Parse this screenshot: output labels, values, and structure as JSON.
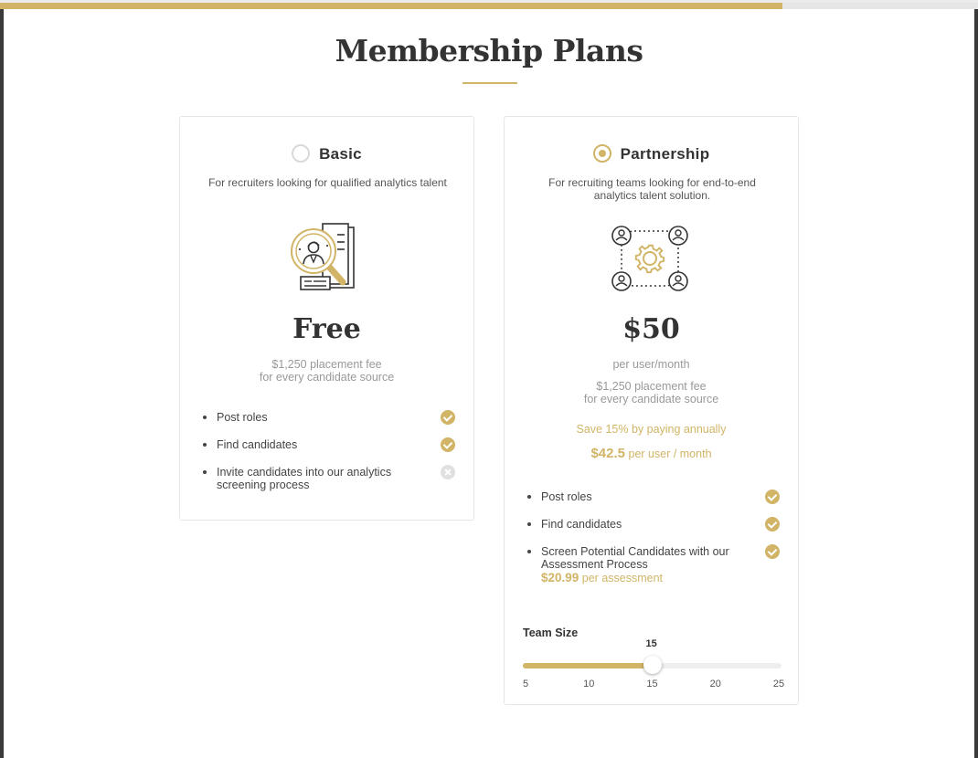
{
  "page": {
    "title": "Membership Plans",
    "progress_percent": 80
  },
  "colors": {
    "accent": "#d1b466",
    "text": "#333333",
    "muted": "#999999",
    "border": "#e6e6e6"
  },
  "plans": {
    "basic": {
      "name": "Basic",
      "selected": false,
      "description": "For recruiters looking for qualified analytics talent",
      "icon": "candidate-search-icon",
      "price": "Free",
      "fee_line1": "$1,250 placement fee",
      "fee_line2": "for every candidate source",
      "features": [
        {
          "label": "Post roles",
          "included": true
        },
        {
          "label": "Find candidates",
          "included": true
        },
        {
          "label": "Invite candidates into our analytics screening process",
          "included": false
        }
      ]
    },
    "partnership": {
      "name": "Partnership",
      "selected": true,
      "description": "For recruiting teams looking for end-to-end analytics talent solution.",
      "icon": "team-network-gear-icon",
      "price": "$50",
      "price_unit": "per user/month",
      "fee_line1": "$1,250 placement fee",
      "fee_line2": "for every candidate source",
      "save_text": "Save 15% by paying annually",
      "annual_price": "$42.5",
      "annual_unit": "per user / month",
      "features": [
        {
          "label": "Post roles",
          "included": true
        },
        {
          "label": "Find candidates",
          "included": true
        },
        {
          "label": "Screen Potential Candidates with our Assessment Process",
          "included": true,
          "price": "$20.99",
          "price_unit": "per assessment"
        }
      ],
      "team_size": {
        "label": "Team Size",
        "value": 15,
        "value_label": "15",
        "min": 5,
        "max": 25,
        "ticks": [
          "5",
          "10",
          "15",
          "20",
          "25"
        ]
      }
    }
  }
}
